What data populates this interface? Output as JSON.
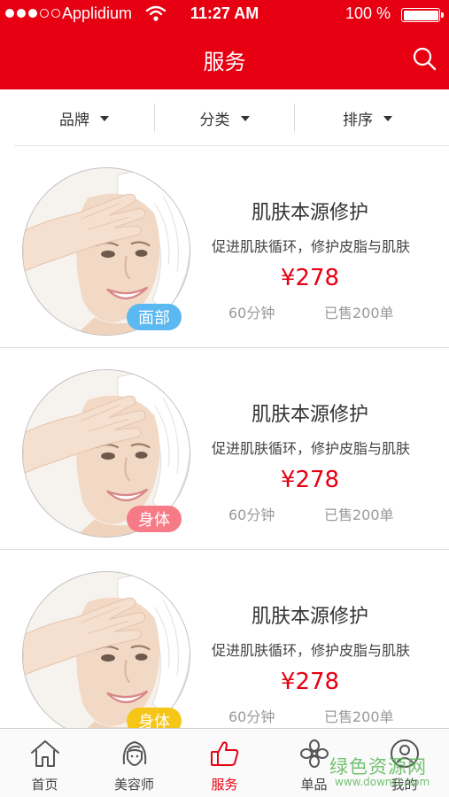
{
  "status_bar": {
    "carrier": "Applidium",
    "time": "11:27 AM",
    "battery": "100 %"
  },
  "header": {
    "title": "服务",
    "icons": [
      "wifi-icon",
      "battery-icon",
      "search-icon"
    ]
  },
  "filters": [
    {
      "label": "品牌"
    },
    {
      "label": "分类"
    },
    {
      "label": "排序"
    }
  ],
  "services": [
    {
      "title": "肌肤本源修护",
      "desc": "促进肌肤循环，修护皮脂与肌肤",
      "price": "¥278",
      "duration": "60分钟",
      "sold": "已售200单",
      "tag": "面部",
      "tag_color": "#5bb8f0"
    },
    {
      "title": "肌肤本源修护",
      "desc": "促进肌肤循环，修护皮脂与肌肤",
      "price": "¥278",
      "duration": "60分钟",
      "sold": "已售200单",
      "tag": "身体",
      "tag_color": "#f77b87"
    },
    {
      "title": "肌肤本源修护",
      "desc": "促进肌肤循环，修护皮脂与肌肤",
      "price": "¥278",
      "duration": "60分钟",
      "sold": "已售200单",
      "tag": "身体",
      "tag_color": "#f5c518"
    }
  ],
  "tabs": [
    {
      "label": "首页",
      "icon": "home-icon"
    },
    {
      "label": "美容师",
      "icon": "beautician-icon"
    },
    {
      "label": "服务",
      "icon": "thumbs-up-icon",
      "active": true
    },
    {
      "label": "单品",
      "icon": "flower-icon"
    },
    {
      "label": "我的",
      "icon": "profile-icon"
    }
  ],
  "watermark": {
    "main": "绿色资源网",
    "sub": "www.downcc.com"
  },
  "colors": {
    "accent": "#e60012",
    "tag_face": "#5bb8f0",
    "tag_body_pink": "#f77b87",
    "tag_body_yellow": "#f5c518"
  }
}
